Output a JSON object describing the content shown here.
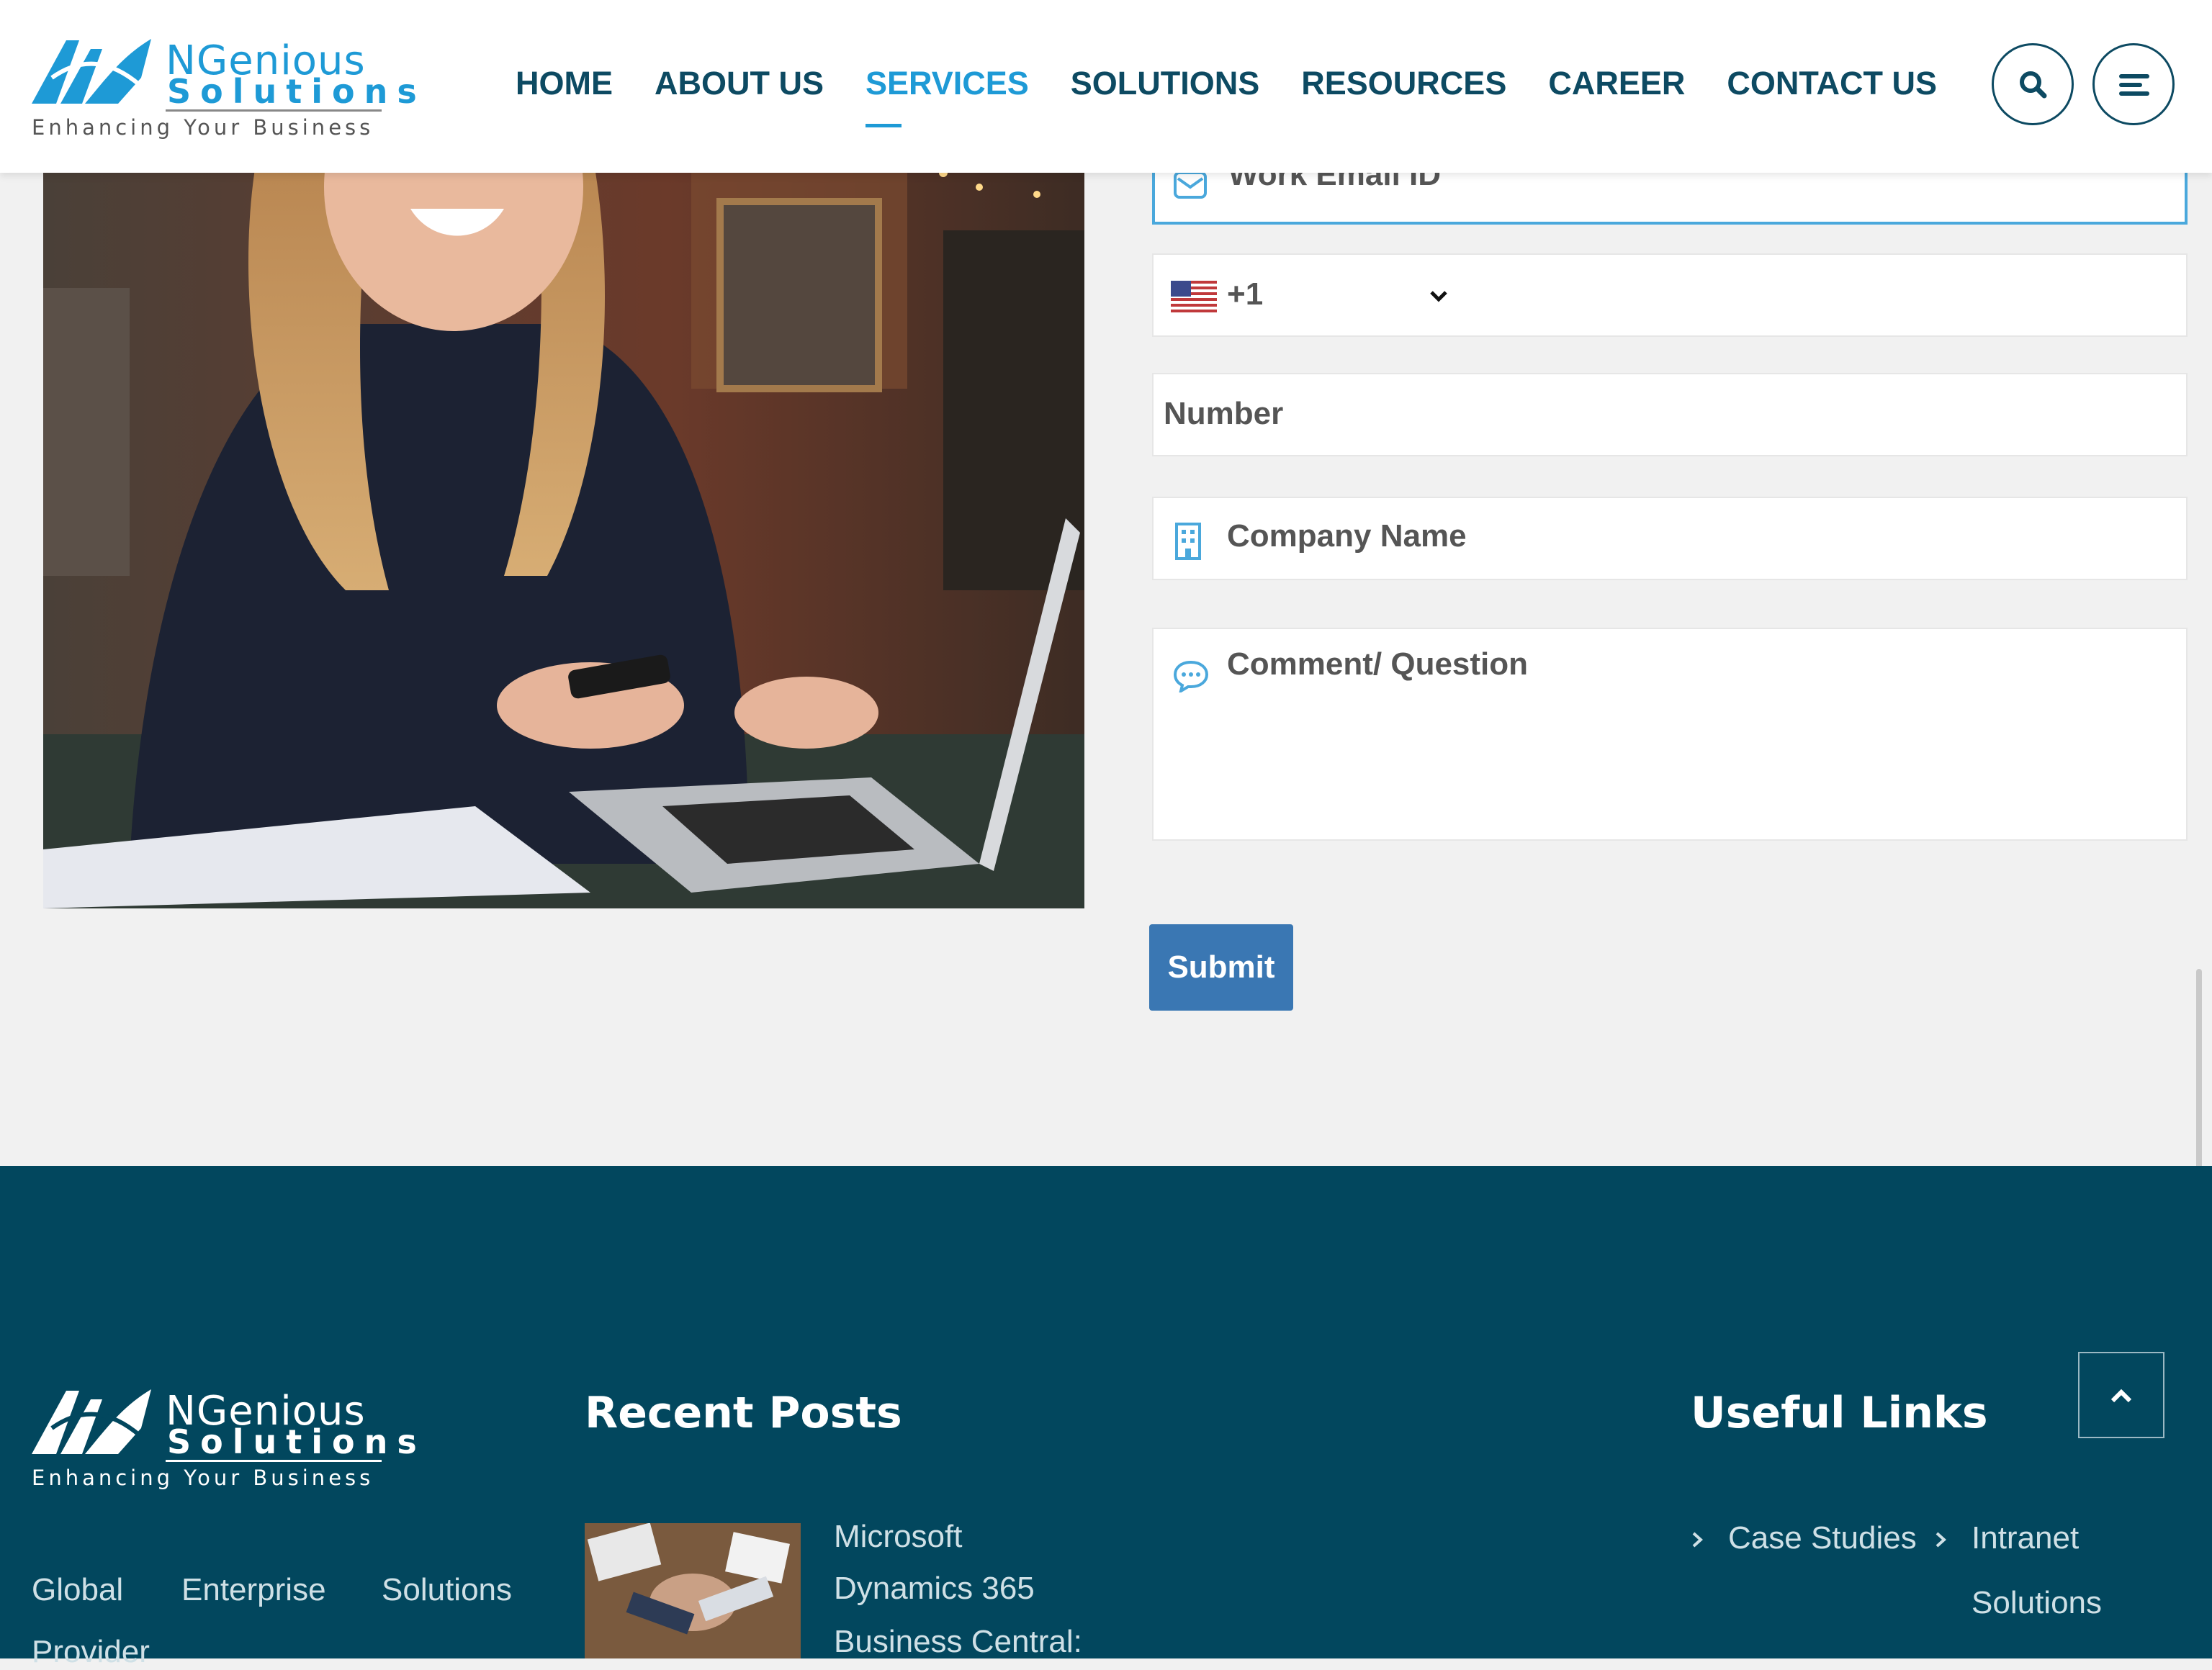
{
  "header": {
    "logo": {
      "brand_line1": "NGenious",
      "brand_line2": "Solutions",
      "tagline": "Enhancing Your Business"
    },
    "nav": [
      {
        "label": "HOME",
        "active": false
      },
      {
        "label": "ABOUT US",
        "active": false
      },
      {
        "label": "SERVICES",
        "active": true
      },
      {
        "label": "SOLUTIONS",
        "active": false
      },
      {
        "label": "RESOURCES",
        "active": false
      },
      {
        "label": "CAREER",
        "active": false
      },
      {
        "label": "CONTACT US",
        "active": false
      }
    ],
    "search_icon": "search-icon",
    "menu_icon": "menu-icon"
  },
  "form": {
    "email_placeholder": "Work Email ID",
    "country_code": "+1",
    "country_flag": "us-flag-icon",
    "number_placeholder": "Number",
    "company_placeholder": "Company Name",
    "comment_placeholder": "Comment/ Question",
    "submit_label": "Submit"
  },
  "footer": {
    "logo": {
      "brand_line1": "NGenious",
      "brand_line2": "Solutions",
      "tagline": "Enhancing Your Business"
    },
    "about_text_line1": [
      "Global",
      "Enterprise",
      "Solutions"
    ],
    "about_text_line2": "Provider",
    "recent_posts_heading": "Recent Posts",
    "recent_post": {
      "lines": [
        "Microsoft",
        "Dynamics 365",
        "Business Central:"
      ]
    },
    "useful_links_heading": "Useful Links",
    "useful_links": [
      "Case Studies",
      "Intranet",
      "Solutions"
    ]
  },
  "colors": {
    "primary": "#0d4a62",
    "accent": "#1e9ad6",
    "footer_bg": "#02475e",
    "submit_bg": "#3a77b3"
  }
}
